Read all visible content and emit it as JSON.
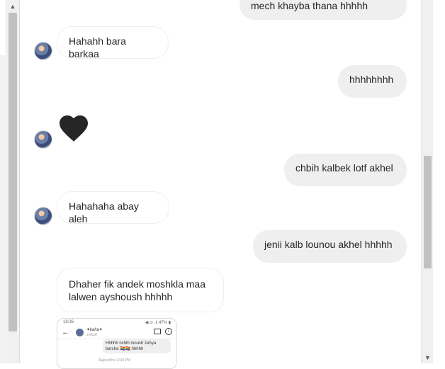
{
  "thread": {
    "messages": [
      {
        "id": "m1",
        "direction": "outgoing",
        "text": "mech khayba thana hhhhh"
      },
      {
        "id": "m2",
        "direction": "incoming",
        "text": "Hahahh bara barkaa"
      },
      {
        "id": "m3",
        "direction": "outgoing",
        "text": "hhhhhhhh"
      },
      {
        "id": "m4",
        "direction": "incoming",
        "type": "heart",
        "color": "#262626"
      },
      {
        "id": "m5",
        "direction": "outgoing",
        "text": "chbih kalbek lotf akhel"
      },
      {
        "id": "m6",
        "direction": "incoming",
        "text": "Hahahaha abay aleh"
      },
      {
        "id": "m7",
        "direction": "outgoing",
        "text": "jenii kalb lounou akhel hhhhh"
      },
      {
        "id": "m8",
        "direction": "incoming",
        "text": "Dhaher fik andek moshkla maa lalwen ayshoush hhhhh"
      }
    ],
    "shared_screenshot": {
      "status_time": "18:36",
      "status_right": "◀ ⊙ .ıl 47% ▮",
      "contact_name": "✦ka/la✦",
      "contact_sub": "zyrka0",
      "message_text": "Hhhhh nchlh moush zehya barcha 🏳️‍🌈🏳️‍🌈 hhhhh",
      "date_text": "Aujourd'hui 3:43 PM"
    }
  },
  "scrollbars": {
    "left_up_arrow": "▲",
    "right_down_arrow": "▼"
  },
  "colors": {
    "outgoing_bg": "#efefef",
    "incoming_border": "#efefef",
    "text": "#262626"
  }
}
